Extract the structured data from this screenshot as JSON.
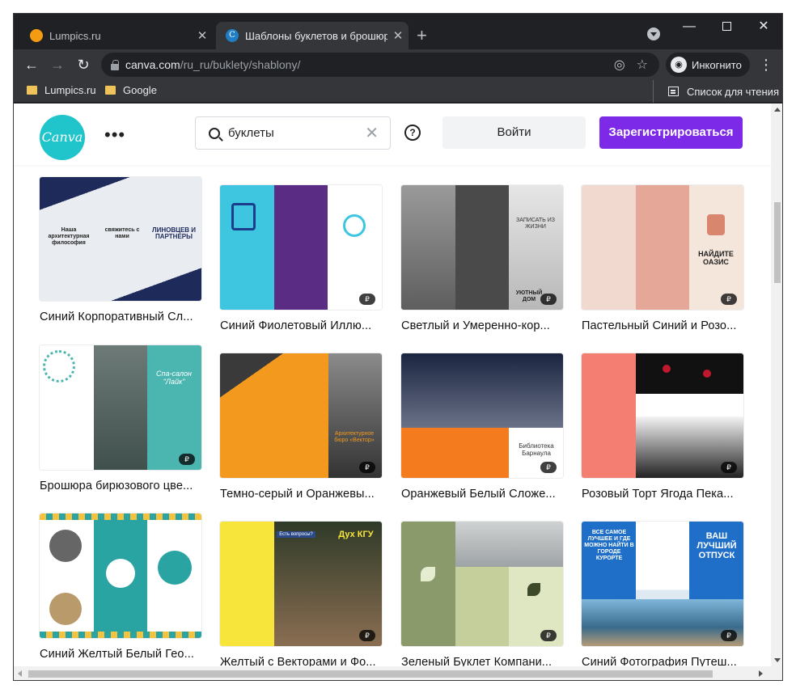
{
  "browser": {
    "tabs": [
      {
        "title": "Lumpics.ru",
        "active": false
      },
      {
        "title": "Шаблоны буклетов и брошюр |",
        "active": true
      }
    ],
    "url_host": "canva.com",
    "url_path": "/ru_ru/buklety/shablony/",
    "profile_label": "Инкогнито",
    "bookmarks": [
      "Lumpics.ru",
      "Google"
    ],
    "reading_list": "Список для чтения"
  },
  "site": {
    "logo_text": "Canva",
    "search_value": "буклеты",
    "login_label": "Войти",
    "signup_label": "Зарегистрироваться",
    "accent_color": "#7d2ae8",
    "brand_color": "#20c4cb"
  },
  "badge_symbol": "₽",
  "templates": [
    {
      "title": "Синий Корпоративный Сл...",
      "thumb": {
        "t1": "Наша архитектурная философия",
        "t2": "свяжитесь с нами",
        "t3": "ЛИНОВЦЕВ И ПАРТНЕРЫ"
      }
    },
    {
      "title": "Синий Фиолетовый Иллю..."
    },
    {
      "title": "Светлый и Умеренно-кор...",
      "thumb": {
        "t1": "ЗАПИСАТЬ ИЗ ЖИЗНИ",
        "t2": "УЮТНЫЙ ДОМ"
      }
    },
    {
      "title": "Пастельный Синий и Розо...",
      "thumb": {
        "t1": "НАЙДИТЕ ОАЗИС"
      }
    },
    {
      "title": "Брошюра бирюзового цве...",
      "thumb": {
        "t1": "Спа-салон \"Лайк\""
      }
    },
    {
      "title": "Темно-серый и Оранжевы...",
      "thumb": {
        "t1": "Архитектурное бюро «Вектор»"
      }
    },
    {
      "title": "Оранжевый Белый Сложе...",
      "thumb": {
        "t1": "Библиотека Барнаула"
      }
    },
    {
      "title": "Розовый Торт Ягода Пека..."
    },
    {
      "title": "Синий Желтый Белый Гео..."
    },
    {
      "title": "Желтый с Векторами и Фо...",
      "thumb": {
        "t1": "Дух КГУ",
        "t2": "Есть вопросы?"
      }
    },
    {
      "title": "Зеленый Буклет Компани..."
    },
    {
      "title": "Синий Фотография Путеш...",
      "thumb": {
        "t1": "ВСЕ САМОЕ ЛУЧШЕЕ И ГДЕ МОЖНО НАЙТИ В ГОРОДЕ КУРОРТЕ",
        "t2": "ВАШ ЛУЧШИЙ ОТПУСК"
      }
    }
  ]
}
